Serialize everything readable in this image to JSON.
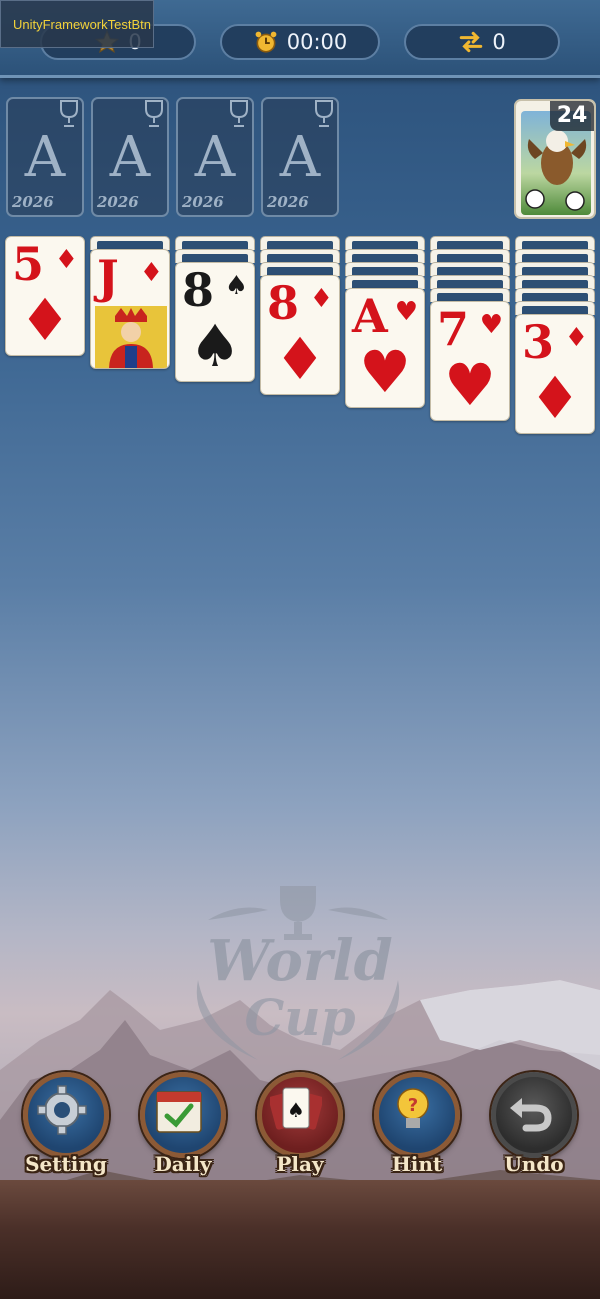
{
  "debug": {
    "label": "UnityFrameworkTestBtn"
  },
  "hud": {
    "stars": "0",
    "timer": "00:00",
    "moves": "0",
    "icons": {
      "stars": "star-icon",
      "timer": "alarm-clock-icon",
      "moves": "swap-arrows-icon"
    }
  },
  "foundations": [
    {
      "label": "A",
      "year": "2026"
    },
    {
      "label": "A",
      "year": "2026"
    },
    {
      "label": "A",
      "year": "2026"
    },
    {
      "label": "A",
      "year": "2026"
    }
  ],
  "stock": {
    "count": "24"
  },
  "tableau": [
    {
      "hidden": 0,
      "rank": "5",
      "suit": "♦",
      "color": "red"
    },
    {
      "hidden": 1,
      "rank": "J",
      "suit": "♦",
      "color": "red",
      "face": true
    },
    {
      "hidden": 2,
      "rank": "8",
      "suit": "♠",
      "color": "black"
    },
    {
      "hidden": 3,
      "rank": "8",
      "suit": "♦",
      "color": "red"
    },
    {
      "hidden": 4,
      "rank": "A",
      "suit": "♥",
      "color": "red"
    },
    {
      "hidden": 5,
      "rank": "7",
      "suit": "♥",
      "color": "red"
    },
    {
      "hidden": 6,
      "rank": "3",
      "suit": "♦",
      "color": "red"
    }
  ],
  "logo": {
    "line1": "World",
    "line2": "Cup"
  },
  "buttons": {
    "setting": "Setting",
    "daily": "Daily",
    "play": "Play",
    "hint": "Hint",
    "undo": "Undo"
  },
  "colors": {
    "card_red": "#d4131b",
    "card_black": "#1a1a1a",
    "label": "#f4e6c8",
    "hud_bg": "#223e5e"
  }
}
